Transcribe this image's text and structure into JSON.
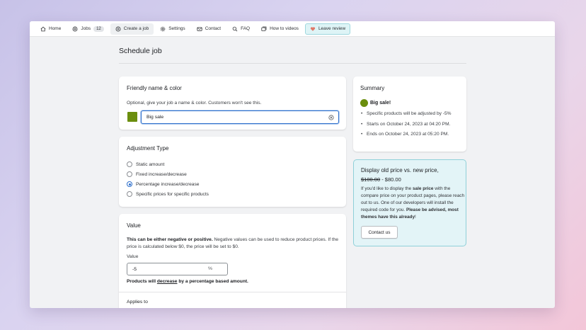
{
  "nav": {
    "home": "Home",
    "jobs": "Jobs",
    "jobs_count": "12",
    "create_job": "Create a job",
    "settings": "Settings",
    "contact": "Contact",
    "faq": "FAQ",
    "how_to_videos": "How to videos",
    "leave_review": "Leave review"
  },
  "page": {
    "title": "Schedule job"
  },
  "friendly": {
    "title": "Friendly name & color",
    "help": "Optional, give your job a name & color. Customers won't see this.",
    "color": "#6b8e0e",
    "name_value": "Big sale"
  },
  "adjustment": {
    "title": "Adjustment Type",
    "options": [
      "Static amount",
      "Fixed increase/decrease",
      "Percentage increase/decrease",
      "Specific prices for specific products"
    ],
    "selected": "Percentage increase/decrease"
  },
  "value": {
    "title": "Value",
    "desc_bold": "This can be either negative or positive.",
    "desc_rest": " Negative values can be used to reduce product prices. If the price is calculated below $0, the price will be set to $0.",
    "field_label": "Value",
    "field_value": "-5",
    "field_suffix": "%",
    "note_1": "Products will ",
    "note_link": "decrease",
    "note_2": " by a percentage based amount."
  },
  "applies": {
    "title": "Applies to"
  },
  "summary": {
    "title": "Summary",
    "job_name": "Big sale!",
    "items": [
      "Specific products will be adjusted by -5%",
      "Starts on October 24, 2023 at 04:20 PM.",
      "Ends on October 24, 2023 at 05:20 PM."
    ]
  },
  "promo": {
    "title": "Display old price vs. new price,",
    "old_price": "$100.00",
    "separator": " - ",
    "new_price": "$80.00",
    "text_1": "If you'd like to display the ",
    "text_bold_1": "sale price",
    "text_2": " with the compare price on your product pages, please reach out to us. One of our developers will install the required code for you. ",
    "text_bold_2": "Please be advised, most themes have this already",
    "text_3": "!",
    "contact_button": "Contact us"
  },
  "colors": {
    "accent": "#2c6ecb",
    "promo_bg": "#e3f4f7",
    "promo_border": "#8fd0d9"
  }
}
